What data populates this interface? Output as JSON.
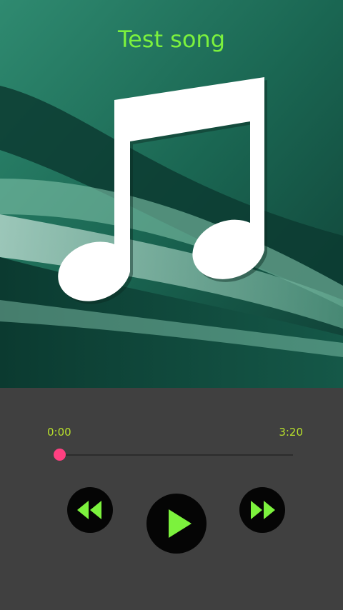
{
  "song": {
    "title": "Test song"
  },
  "artwork": {
    "icon": "music-note-icon"
  },
  "playback": {
    "elapsed": "0:00",
    "total": "3:20",
    "progress": 0.0
  },
  "controls": {
    "rewind_icon": "rewind-icon",
    "play_icon": "play-icon",
    "forward_icon": "fast-forward-icon"
  },
  "colors": {
    "accent_green": "#7cf23d",
    "time_text": "#b8e02c",
    "seek_accent": "#ff4081",
    "panel_bg": "#404040"
  }
}
